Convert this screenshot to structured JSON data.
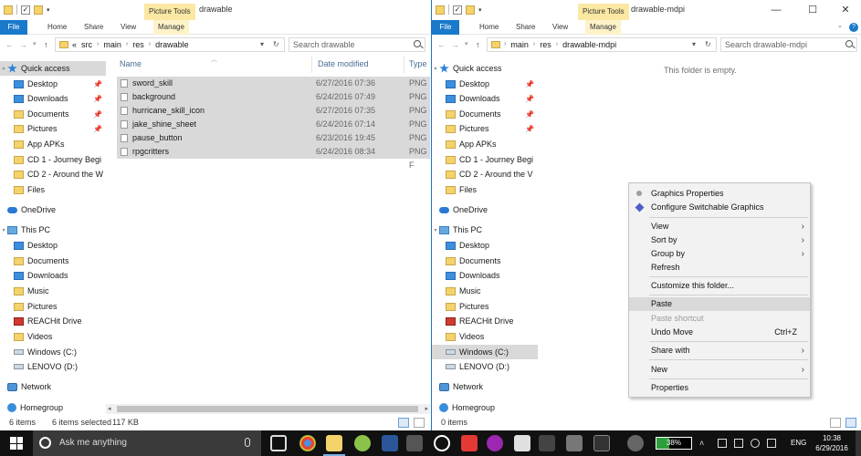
{
  "left_window": {
    "title": "drawable",
    "context_tab": "Picture Tools",
    "ribbon_tabs": [
      "File",
      "Home",
      "Share",
      "View",
      "Manage"
    ],
    "address": {
      "prefix": "«",
      "crumbs": [
        "src",
        "main",
        "res",
        "drawable"
      ]
    },
    "search_placeholder": "Search drawable",
    "columns": [
      "Name",
      "Date modified",
      "Type"
    ],
    "files": [
      {
        "name": "sword_skill",
        "date": "6/27/2016 07:36",
        "type": "PNG F"
      },
      {
        "name": "background",
        "date": "6/24/2016 07:49",
        "type": "PNG F"
      },
      {
        "name": "hurricane_skill_icon",
        "date": "6/27/2016 07:35",
        "type": "PNG F"
      },
      {
        "name": "jake_shine_sheet",
        "date": "6/24/2016 07:14",
        "type": "PNG F"
      },
      {
        "name": "pause_button",
        "date": "6/23/2016 19:45",
        "type": "PNG F"
      },
      {
        "name": "rpgcritters",
        "date": "6/24/2016 08:34",
        "type": "PNG F"
      }
    ],
    "status": {
      "count": "6 items",
      "selected": "6 items selected",
      "size": "117 KB"
    }
  },
  "right_window": {
    "title": "drawable-mdpi",
    "context_tab": "Picture Tools",
    "ribbon_tabs": [
      "File",
      "Home",
      "Share",
      "View",
      "Manage"
    ],
    "address": {
      "crumbs": [
        "main",
        "res",
        "drawable-mdpi"
      ]
    },
    "search_placeholder": "Search drawable-mdpi",
    "empty_message": "This folder is empty.",
    "status": {
      "count": "0 items"
    }
  },
  "nav_pane": {
    "quick_access": "Quick access",
    "pinned": [
      "Desktop",
      "Downloads",
      "Documents",
      "Pictures"
    ],
    "recent": [
      "App APKs",
      "CD 1 - Journey Begi",
      "CD 2 - Around the W",
      "Files"
    ],
    "right_recent": [
      "App APKs",
      "CD 1 - Journey Begi",
      "CD 2 - Around the V",
      "Files"
    ],
    "onedrive": "OneDrive",
    "this_pc": "This PC",
    "pc_items": [
      "Desktop",
      "Documents",
      "Downloads",
      "Music",
      "Pictures",
      "REACHit Drive",
      "Videos",
      "Windows (C:)",
      "LENOVO (D:)"
    ],
    "network": "Network",
    "homegroup": "Homegroup"
  },
  "context_menu": {
    "items": {
      "graphics_properties": "Graphics Properties",
      "configure_graphics": "Configure Switchable Graphics",
      "view": "View",
      "sort_by": "Sort by",
      "group_by": "Group by",
      "refresh": "Refresh",
      "customize": "Customize this folder...",
      "paste": "Paste",
      "paste_shortcut": "Paste shortcut",
      "undo_move": "Undo Move",
      "undo_shortcut": "Ctrl+Z",
      "share_with": "Share with",
      "new": "New",
      "properties": "Properties"
    }
  },
  "taskbar": {
    "search_placeholder": "Ask me anything",
    "battery_text": "38%",
    "battery_level": 0.38,
    "language": "ENG",
    "time": "10:38",
    "date": "6/29/2016"
  }
}
